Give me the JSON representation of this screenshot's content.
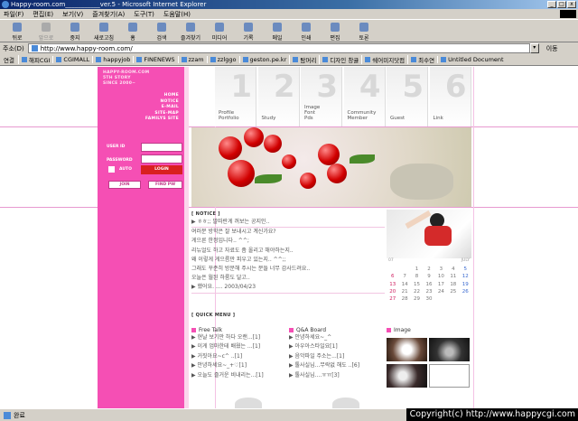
{
  "window": {
    "title": "Happy-room.com___________ver.5 - Microsoft Internet Explorer",
    "controls": [
      "_",
      "□",
      "x"
    ]
  },
  "menu": [
    "파일(F)",
    "편집(E)",
    "보기(V)",
    "즐겨찾기(A)",
    "도구(T)",
    "도움말(H)"
  ],
  "toolbar": [
    {
      "label": "뒤로",
      "icon": "back-arrow-icon",
      "dim": false
    },
    {
      "label": "앞으로",
      "icon": "forward-arrow-icon",
      "dim": true
    },
    {
      "label": "중지",
      "icon": "stop-icon",
      "dim": false
    },
    {
      "label": "새로고침",
      "icon": "refresh-icon",
      "dim": false
    },
    {
      "label": "홈",
      "icon": "home-icon",
      "dim": false
    },
    {
      "label": "검색",
      "icon": "search-icon",
      "dim": false
    },
    {
      "label": "즐겨찾기",
      "icon": "favorites-icon",
      "dim": false
    },
    {
      "label": "미디어",
      "icon": "media-icon",
      "dim": false
    },
    {
      "label": "기록",
      "icon": "history-icon",
      "dim": false
    },
    {
      "label": "메일",
      "icon": "mail-icon",
      "dim": false
    },
    {
      "label": "인쇄",
      "icon": "print-icon",
      "dim": false
    },
    {
      "label": "편집",
      "icon": "edit-icon",
      "dim": false
    },
    {
      "label": "토론",
      "icon": "discuss-icon",
      "dim": false
    }
  ],
  "address": {
    "label": "주소(D)",
    "url": "http://www.happy-room.com/",
    "go": "이동"
  },
  "links": {
    "label": "연결",
    "items": [
      "해피CGI",
      "CGIMALL",
      "happyjob",
      "FINENEWS",
      "zzam",
      "zzlggo",
      "geston.pe.kr",
      "탐머리",
      "디자인 창귤",
      "쉐어미지닷컴",
      "최수연",
      "Untitled Document"
    ]
  },
  "site": {
    "brand": [
      "HAPPY-ROOM.COM",
      "5TH STORY",
      "SINCE 2000~"
    ],
    "nav": [
      "HOME",
      "NOTICE",
      "E-MAIL",
      "SITE-MAP",
      "FAMILYS SITE"
    ],
    "login": {
      "user_label": "USER ID",
      "pass_label": "PASSWORD",
      "auto_label": "AUTO",
      "login_btn": "LOGIN",
      "join_btn": "JOIN",
      "find_btn": "FIND PW"
    },
    "tabs": [
      {
        "num": "1",
        "label": "Profile\nPortfolio"
      },
      {
        "num": "2",
        "label": "Study"
      },
      {
        "num": "3",
        "label": "Image\nFont\nPds"
      },
      {
        "num": "4",
        "label": "Community\nMember"
      },
      {
        "num": "5",
        "label": "Guest"
      },
      {
        "num": "6",
        "label": "Link"
      }
    ],
    "notice": {
      "title": "[ NOTICE ]",
      "items": [
        "▶ ㅎㅎ;; 말따란게 꺼보는 공지인..",
        "여러분 방학은 잘 보내시고 계신가요?",
        "게으른 한정입니다.. ^^;",
        "리뉴얼도 하고 자료도 좀 올리고 해야하는지..",
        "왜 이렇게 게으름만 피우고 있는지.. ^^;;",
        "그래도 꾸준히 방문해 주시는 분들 너무 감사드려요..",
        "오늘은 월된 하룸도 달고..",
        "▶ 했어요.  .... 2003/04/23"
      ]
    },
    "calendar": {
      "month": "07",
      "month_name": "JULY",
      "rows": [
        [
          "",
          "",
          "1",
          "2",
          "3",
          "4",
          "5"
        ],
        [
          "6",
          "7",
          "8",
          "9",
          "10",
          "11",
          "12"
        ],
        [
          "13",
          "14",
          "15",
          "16",
          "17",
          "18",
          "19"
        ],
        [
          "20",
          "21",
          "22",
          "23",
          "24",
          "25",
          "26"
        ],
        [
          "27",
          "28",
          "29",
          "30",
          "",
          "",
          ""
        ]
      ]
    },
    "quick_menu": "[ QUICK MENU ]",
    "free_talk": {
      "title": "Free Talk",
      "items": [
        "▶ 현날 보기만 하다 오랜...[1]",
        "▶ 이게 엄마한테 배웠는 ...[1]",
        "▶ 거짓아요~c^ ..[1]",
        "▶ 안녕하세요~_+♡[1]",
        "▶ 오늘도 즐거운 비내리는...[1]"
      ]
    },
    "qa_board": {
      "title": "Q&A Board",
      "items": [
        "▶ 안녕하세요~_^",
        "▶ 아우아스타일요[1]",
        "▶ 음악파일 주소는...[1]",
        "▶ 톨사실님...무락없 해도 ..[6]",
        "▶ 톨사실님....ㅠㅠ[3]"
      ]
    },
    "image": {
      "title": "Image"
    }
  },
  "status": {
    "text": "완료"
  },
  "copyright": "Copyright(c) http://www.happycgi.com"
}
